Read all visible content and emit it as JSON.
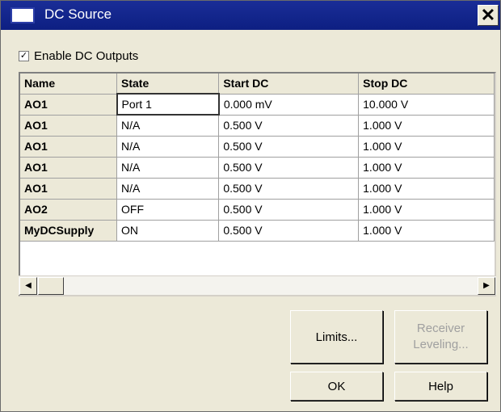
{
  "window": {
    "title": "DC Source",
    "close_label": "✕"
  },
  "enable": {
    "label": "Enable DC Outputs",
    "checked": true
  },
  "table": {
    "headers": [
      "Name",
      "State",
      "Start DC",
      "Stop DC"
    ],
    "rows": [
      [
        "AO1",
        "Port 1",
        "0.000 mV",
        "10.000 V"
      ],
      [
        "AO1",
        "N/A",
        "0.500 V",
        "1.000 V"
      ],
      [
        "AO1",
        "N/A",
        "0.500 V",
        "1.000 V"
      ],
      [
        "AO1",
        "N/A",
        "0.500 V",
        "1.000 V"
      ],
      [
        "AO1",
        "N/A",
        "0.500 V",
        "1.000 V"
      ],
      [
        "AO2",
        "OFF",
        "0.500 V",
        "1.000 V"
      ],
      [
        "MyDCSupply",
        "ON",
        "0.500 V",
        "1.000 V"
      ]
    ]
  },
  "buttons": {
    "limits": "Limits...",
    "receiver_leveling_line1": "Receiver",
    "receiver_leveling_line2": "Leveling...",
    "ok": "OK",
    "help": "Help"
  }
}
